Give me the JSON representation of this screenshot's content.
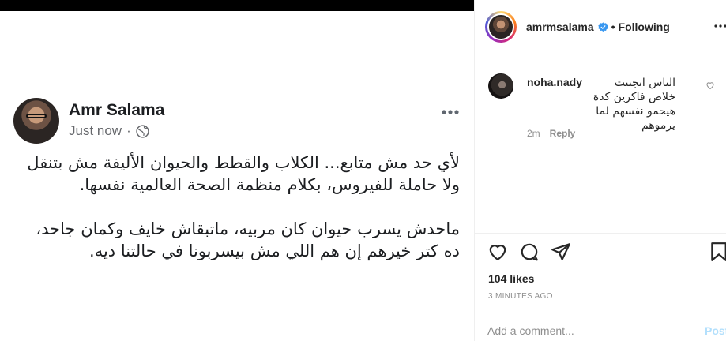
{
  "post": {
    "author_name": "Amr Salama",
    "time_label": "Just now",
    "separator": "·",
    "paragraph_1": "لأي حد مش متابع... الكلاب والقطط والحيوان الأليفة مش بتنقل ولا حاملة للفيروس، بكلام منظمة الصحة العالمية نفسها.",
    "paragraph_2": "ماحدش يسرب حيوان كان مربيه، ماتبقاش خايف وكمان جاحد، ده كتر خيرهم إن هم اللي مش بيسربونا في حالتنا ديه."
  },
  "header": {
    "username": "amrmsalama",
    "dot": "•",
    "follow_status": "Following"
  },
  "comment": {
    "username": "noha.nady",
    "text": "الناس اتجننت خلاص فاكرين كدة هيحمو نفسهم لما يرموهم",
    "age": "2m",
    "reply_label": "Reply"
  },
  "stats": {
    "likes": "104 likes",
    "posted": "3 MINUTES AGO"
  },
  "composer": {
    "placeholder": "Add a comment...",
    "post_label": "Post"
  },
  "colors": {
    "verified": "#3897f0",
    "post_button": "#b2dffc",
    "muted_text": "#8e8e8e"
  },
  "icons": [
    "globe-icon",
    "more-horizontal-icon",
    "verified-badge-icon",
    "heart-icon",
    "comment-icon",
    "share-icon",
    "bookmark-icon"
  ]
}
